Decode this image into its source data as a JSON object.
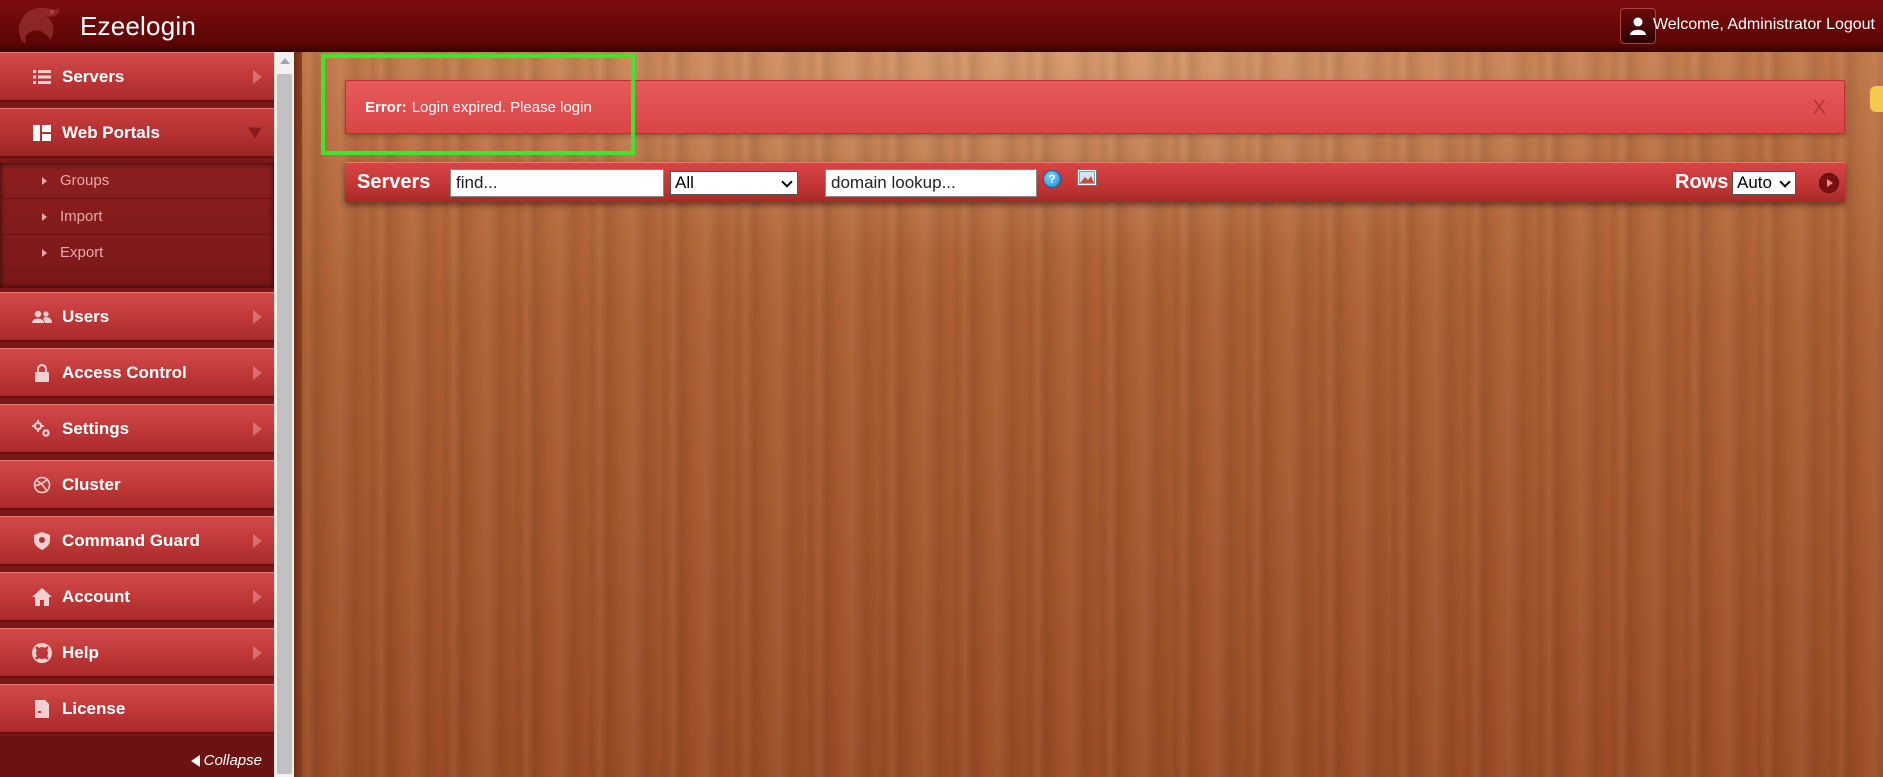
{
  "header": {
    "title": "Ezeelogin",
    "welcome_text": "Welcome, Administrator",
    "logout_label": "Logout"
  },
  "sidebar": {
    "items": [
      {
        "label": "Servers",
        "icon": "list-icon"
      },
      {
        "label": "Web Portals",
        "icon": "dashboard-icon"
      },
      {
        "label": "Users",
        "icon": "users-icon"
      },
      {
        "label": "Access Control",
        "icon": "lock-icon"
      },
      {
        "label": "Settings",
        "icon": "gears-icon"
      },
      {
        "label": "Cluster",
        "icon": "globe-icon"
      },
      {
        "label": "Command Guard",
        "icon": "shield-icon"
      },
      {
        "label": "Account",
        "icon": "home-icon"
      },
      {
        "label": "Help",
        "icon": "lifebuoy-icon"
      },
      {
        "label": "License",
        "icon": "document-icon"
      }
    ],
    "submenu": [
      {
        "label": "Groups"
      },
      {
        "label": "Import"
      },
      {
        "label": "Export"
      }
    ],
    "collapse_label": "Collapse"
  },
  "alert": {
    "strong": "Error:",
    "message": "Login expired. Please login",
    "close_label": "X"
  },
  "toolbar": {
    "title": "Servers",
    "find_value": "find...",
    "filter_value": "All",
    "domain_value": "domain lookup...",
    "help_label": "?",
    "rows_label": "Rows",
    "rows_value": "Auto"
  },
  "colors": {
    "header_bg": "#5c0505",
    "nav_bg": "#be3737",
    "alert_bg": "#d84545",
    "highlight_border": "#3ee52b",
    "wood": "#ad5f33"
  }
}
